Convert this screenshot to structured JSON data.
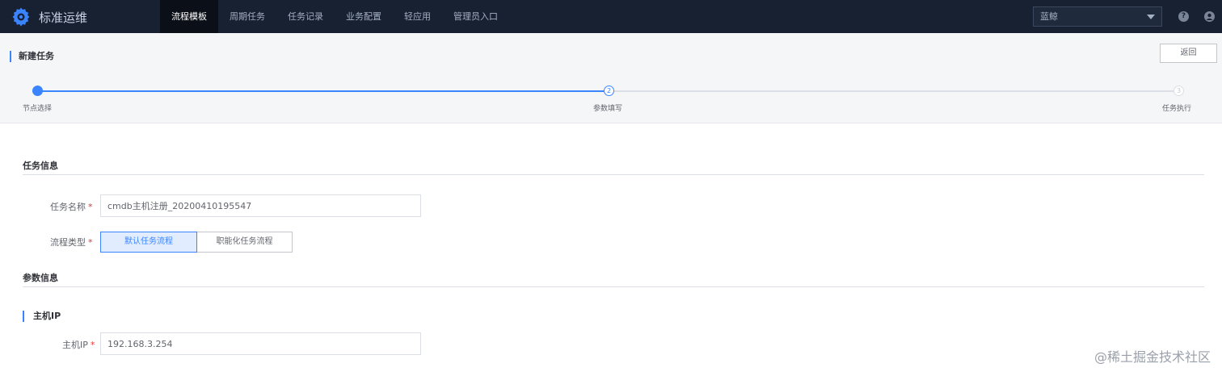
{
  "header": {
    "brand": "标准运维",
    "nav": [
      {
        "label": "流程模板",
        "active": true
      },
      {
        "label": "周期任务",
        "active": false
      },
      {
        "label": "任务记录",
        "active": false
      },
      {
        "label": "业务配置",
        "active": false
      },
      {
        "label": "轻应用",
        "active": false
      },
      {
        "label": "管理员入口",
        "active": false
      }
    ],
    "business_select": "蓝鲸",
    "help_icon": "question-circle-icon",
    "user_icon": "user-avatar-icon"
  },
  "subheader": {
    "title": "新建任务",
    "back_label": "返回"
  },
  "steps": {
    "items": [
      {
        "label": "节点选择",
        "number": "",
        "state": "done"
      },
      {
        "label": "参数填写",
        "number": "2",
        "state": "current"
      },
      {
        "label": "任务执行",
        "number": "3",
        "state": "todo"
      }
    ],
    "progress": 0.5
  },
  "task_info": {
    "section_title": "任务信息",
    "name_label": "任务名称",
    "name_value": "cmdb主机注册_20200410195547",
    "flow_type_label": "流程类型",
    "flow_types": [
      {
        "label": "默认任务流程",
        "active": true
      },
      {
        "label": "职能化任务流程",
        "active": false
      }
    ]
  },
  "params": {
    "section_title": "参数信息",
    "group_title": "主机IP",
    "host_ip_label": "主机IP",
    "host_ip_value": "192.168.3.254"
  },
  "watermark": "@稀土掘金技术社区",
  "colors": {
    "nav_bg": "#182132",
    "accent": "#3a84ff",
    "required": "#ea3636"
  }
}
